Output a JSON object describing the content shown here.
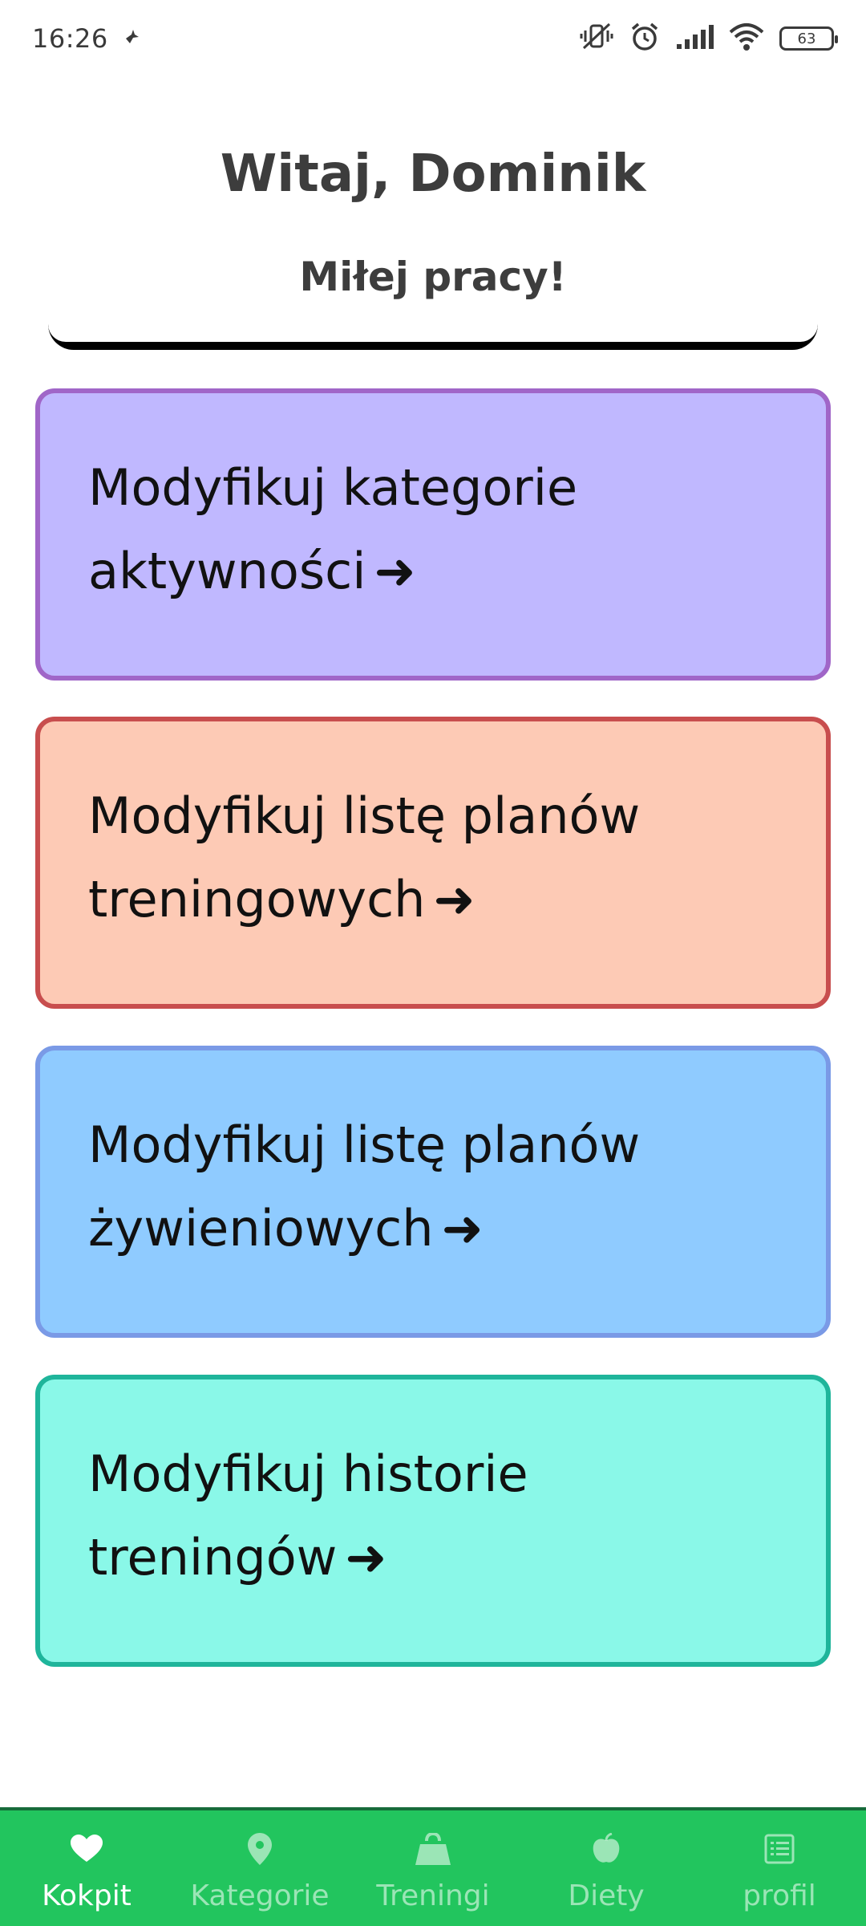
{
  "status_bar": {
    "time": "16:26",
    "battery_level": "63",
    "icons": [
      "bird-icon",
      "mute-vibrate-icon",
      "alarm-icon",
      "signal-icon",
      "wifi-icon",
      "battery-icon"
    ]
  },
  "header": {
    "greeting": "Witaj, Dominik",
    "subtitle": "Miłej pracy!"
  },
  "cards": [
    {
      "label": "Modyfikuj kategorie aktywności",
      "arrow": "➜",
      "bg": "#c0b8ff",
      "border": "#a066c8"
    },
    {
      "label": "Modyfikuj listę planów treningowych",
      "arrow": "➜",
      "bg": "#fdcab5",
      "border": "#c84e4e"
    },
    {
      "label": "Modyfikuj listę planów żywieniowych",
      "arrow": "➜",
      "bg": "#8fcbff",
      "border": "#7a9ae6"
    },
    {
      "label": "Modyfikuj historie treningów",
      "arrow": "➜",
      "bg": "#8af8e8",
      "border": "#1fb59b"
    }
  ],
  "bottom_nav": {
    "items": [
      {
        "label": "Kokpit",
        "icon": "heart-icon",
        "active": true
      },
      {
        "label": "Kategorie",
        "icon": "map-pin-icon",
        "active": false
      },
      {
        "label": "Treningi",
        "icon": "kettlebell-icon",
        "active": false
      },
      {
        "label": "Diety",
        "icon": "apple-icon",
        "active": false
      },
      {
        "label": "profil",
        "icon": "list-icon",
        "active": false
      }
    ],
    "bg_color": "#22c55e"
  }
}
